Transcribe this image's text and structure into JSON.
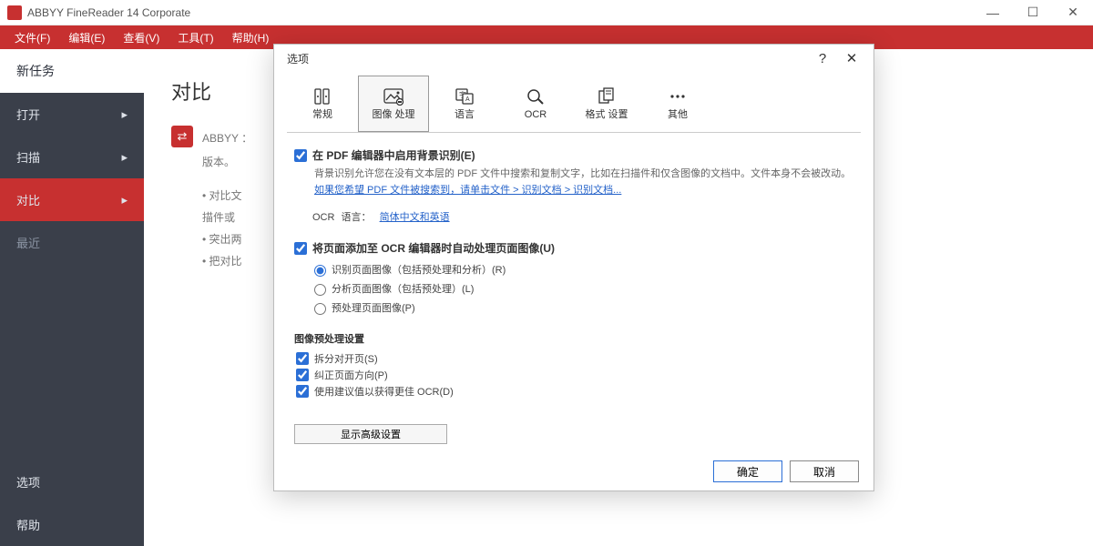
{
  "window": {
    "title": "ABBYY FineReader 14 Corporate"
  },
  "menubar": [
    "文件(F)",
    "编辑(E)",
    "查看(V)",
    "工具(T)",
    "帮助(H)"
  ],
  "sidebar": {
    "newtask": "新任务",
    "items": [
      {
        "label": "打开"
      },
      {
        "label": "扫描"
      },
      {
        "label": "对比"
      },
      {
        "label": "最近"
      }
    ],
    "bottom": [
      {
        "label": "选项"
      },
      {
        "label": "帮助"
      }
    ]
  },
  "content": {
    "heading": "对比",
    "line1": "ABBYY ：",
    "line2": "版本。",
    "bullets": [
      "• 对比文",
      "描件或",
      "• 突出两",
      "• 把对比"
    ]
  },
  "dialog": {
    "title": "选项",
    "tabs": [
      {
        "label": "常规"
      },
      {
        "label": "图像\n处理"
      },
      {
        "label": "语言"
      },
      {
        "label": "OCR"
      },
      {
        "label": "格式\n设置"
      },
      {
        "label": "其他"
      }
    ],
    "active_tab": 1,
    "chk1": {
      "label": "在 PDF 编辑器中启用背景识别(E)",
      "checked": true
    },
    "chk1_desc1": "背景识别允许您在没有文本层的 PDF 文件中搜索和复制文字，比如在扫描件和仅含图像的文档中。文件本身不会被改动。",
    "chk1_desc2_a": "如果您希望 PDF 文件被搜索到，请单击文件 > 识别文档 > 识别文档...",
    "ocr_label": "OCR",
    "lang_label": "语言：",
    "lang_link": "简体中文和英语",
    "chk2": {
      "label": "将页面添加至 OCR 编辑器时自动处理页面图像(U)",
      "checked": true
    },
    "radios": [
      {
        "label": "识别页面图像（包括预处理和分析）(R)",
        "checked": true
      },
      {
        "label": "分析页面图像（包括预处理）(L)",
        "checked": false
      },
      {
        "label": "预处理页面图像(P)",
        "checked": false
      }
    ],
    "section": "图像预处理设置",
    "chk3": [
      {
        "label": "拆分对开页(S)",
        "checked": true
      },
      {
        "label": "纠正页面方向(P)",
        "checked": true
      },
      {
        "label": "使用建议值以获得更佳 OCR(D)",
        "checked": true
      }
    ],
    "adv_button": "显示高级设置",
    "ok": "确定",
    "cancel": "取消"
  }
}
